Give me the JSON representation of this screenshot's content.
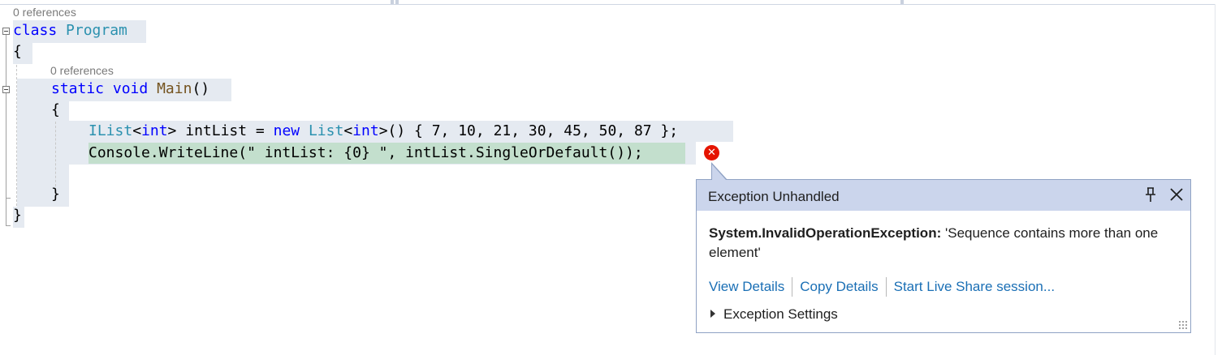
{
  "codelens": {
    "class_refs": "0 references",
    "method_refs": "0 references"
  },
  "code": {
    "l1_kw": "class",
    "l1_type": "Program",
    "l2": "{",
    "l3_kw1": "static",
    "l3_kw2": "void",
    "l3_fn": "Main",
    "l3_rest": "()",
    "l4": "{",
    "l5_type1": "IList",
    "l5_lt": "<",
    "l5_kw1": "int",
    "l5_gt": ">",
    "l5_var": "intList",
    "l5_eq": " = ",
    "l5_new": "new",
    "l5_type2": "List",
    "l5_lt2": "<",
    "l5_kw2": "int",
    "l5_rest": ">() { 7, 10, 21, 30, 45, 50, 87 };",
    "l6": "Console.WriteLine(\" intList: {0} \", intList.SingleOrDefault());",
    "l8": "}",
    "l9": "}"
  },
  "exception": {
    "title": "Exception Unhandled",
    "type": "System.InvalidOperationException:",
    "message": "'Sequence contains more than one element'",
    "view_details": "View Details",
    "copy_details": "Copy Details",
    "live_share": "Start Live Share session...",
    "settings": "Exception Settings"
  },
  "icons": {
    "error": "error-circle-icon",
    "pin": "pin-icon",
    "close": "close-icon",
    "expand": "expand-triangle-icon",
    "grip": "resize-grip-icon"
  },
  "colors": {
    "keyword": "#0000ff",
    "type": "#2b91af",
    "method": "#74531f",
    "current_line": "#c3dfcd",
    "popup_header": "#cbd5ec",
    "error": "#e51400",
    "link": "#1a6fb5"
  }
}
